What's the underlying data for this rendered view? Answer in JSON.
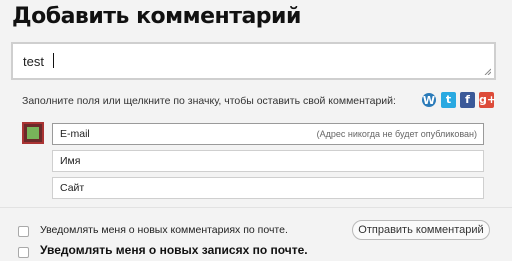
{
  "title": "Добавить комментарий",
  "comment": {
    "value": "test"
  },
  "hint": "Заполните поля или щелкните по значку, чтобы оставить свой комментарий:",
  "social": {
    "wordpress": "W",
    "twitter": "t",
    "facebook": "f",
    "googleplus": "g+"
  },
  "fields": {
    "email": {
      "label": "E-mail",
      "note": "(Адрес никогда не будет опубликован)"
    },
    "name": {
      "label": "Имя"
    },
    "site": {
      "label": "Сайт"
    }
  },
  "notify": {
    "comments": "Уведомлять меня о новых комментариях по почте.",
    "posts": "Уведомлять меня о новых записях по почте."
  },
  "submit": "Отправить комментарий",
  "colors": {
    "wordpress": "#2b7bb9",
    "twitter": "#29a9e1",
    "facebook": "#3b5998",
    "googleplus": "#dd4b39"
  }
}
